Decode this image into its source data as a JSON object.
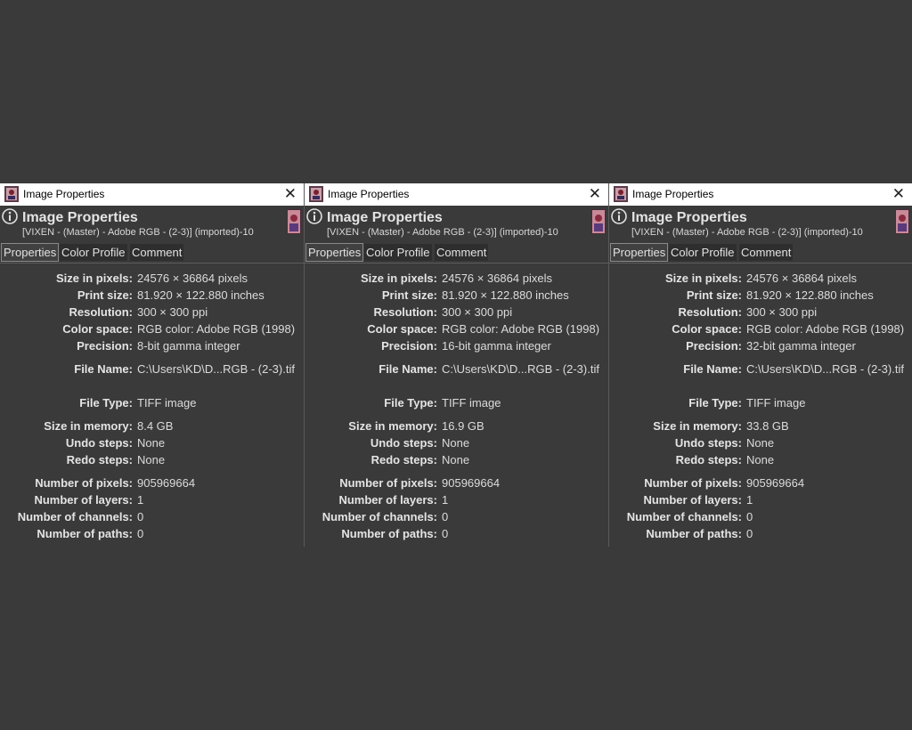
{
  "windows": [
    {
      "title": "Image Properties",
      "close": "✕",
      "header": {
        "title": "Image Properties",
        "subtitle": "[VIXEN - (Master) - Adobe RGB - (2-3)] (imported)-10"
      },
      "tabs": [
        "Properties",
        "Color Profile",
        "Comment"
      ],
      "fields": {
        "size_in_pixels": {
          "label": "Size in pixels:",
          "value": "24576 × 36864 pixels"
        },
        "print_size": {
          "label": "Print size:",
          "value": "81.920 × 122.880 inches"
        },
        "resolution": {
          "label": "Resolution:",
          "value": "300 × 300 ppi"
        },
        "color_space": {
          "label": "Color space:",
          "value": "RGB color: Adobe RGB (1998)"
        },
        "precision": {
          "label": "Precision:",
          "value": "8-bit gamma integer"
        },
        "file_name": {
          "label": "File Name:",
          "value": "C:\\Users\\KD\\D...RGB - (2-3).tif"
        },
        "file_type": {
          "label": "File Type:",
          "value": "TIFF image"
        },
        "size_in_memory": {
          "label": "Size in memory:",
          "value": "8.4 GB"
        },
        "undo_steps": {
          "label": "Undo steps:",
          "value": "None"
        },
        "redo_steps": {
          "label": "Redo steps:",
          "value": "None"
        },
        "number_of_pixels": {
          "label": "Number of pixels:",
          "value": "905969664"
        },
        "number_of_layers": {
          "label": "Number of layers:",
          "value": "1"
        },
        "number_of_channels": {
          "label": "Number of channels:",
          "value": "0"
        },
        "number_of_paths": {
          "label": "Number of paths:",
          "value": "0"
        }
      }
    },
    {
      "title": "Image Properties",
      "close": "✕",
      "header": {
        "title": "Image Properties",
        "subtitle": "[VIXEN - (Master) - Adobe RGB - (2-3)] (imported)-10"
      },
      "tabs": [
        "Properties",
        "Color Profile",
        "Comment"
      ],
      "fields": {
        "size_in_pixels": {
          "label": "Size in pixels:",
          "value": "24576 × 36864 pixels"
        },
        "print_size": {
          "label": "Print size:",
          "value": "81.920 × 122.880 inches"
        },
        "resolution": {
          "label": "Resolution:",
          "value": "300 × 300 ppi"
        },
        "color_space": {
          "label": "Color space:",
          "value": "RGB color: Adobe RGB (1998)"
        },
        "precision": {
          "label": "Precision:",
          "value": "16-bit gamma integer"
        },
        "file_name": {
          "label": "File Name:",
          "value": "C:\\Users\\KD\\D...RGB - (2-3).tif"
        },
        "file_type": {
          "label": "File Type:",
          "value": "TIFF image"
        },
        "size_in_memory": {
          "label": "Size in memory:",
          "value": "16.9 GB"
        },
        "undo_steps": {
          "label": "Undo steps:",
          "value": "None"
        },
        "redo_steps": {
          "label": "Redo steps:",
          "value": "None"
        },
        "number_of_pixels": {
          "label": "Number of pixels:",
          "value": "905969664"
        },
        "number_of_layers": {
          "label": "Number of layers:",
          "value": "1"
        },
        "number_of_channels": {
          "label": "Number of channels:",
          "value": "0"
        },
        "number_of_paths": {
          "label": "Number of paths:",
          "value": "0"
        }
      }
    },
    {
      "title": "Image Properties",
      "close": "✕",
      "header": {
        "title": "Image Properties",
        "subtitle": "[VIXEN - (Master) - Adobe RGB - (2-3)] (imported)-10"
      },
      "tabs": [
        "Properties",
        "Color Profile",
        "Comment"
      ],
      "fields": {
        "size_in_pixels": {
          "label": "Size in pixels:",
          "value": "24576 × 36864 pixels"
        },
        "print_size": {
          "label": "Print size:",
          "value": "81.920 × 122.880 inches"
        },
        "resolution": {
          "label": "Resolution:",
          "value": "300 × 300 ppi"
        },
        "color_space": {
          "label": "Color space:",
          "value": "RGB color: Adobe RGB (1998)"
        },
        "precision": {
          "label": "Precision:",
          "value": "32-bit gamma integer"
        },
        "file_name": {
          "label": "File Name:",
          "value": "C:\\Users\\KD\\D...RGB - (2-3).tif"
        },
        "file_type": {
          "label": "File Type:",
          "value": "TIFF image"
        },
        "size_in_memory": {
          "label": "Size in memory:",
          "value": "33.8 GB"
        },
        "undo_steps": {
          "label": "Undo steps:",
          "value": "None"
        },
        "redo_steps": {
          "label": "Redo steps:",
          "value": "None"
        },
        "number_of_pixels": {
          "label": "Number of pixels:",
          "value": "905969664"
        },
        "number_of_layers": {
          "label": "Number of layers:",
          "value": "1"
        },
        "number_of_channels": {
          "label": "Number of channels:",
          "value": "0"
        },
        "number_of_paths": {
          "label": "Number of paths:",
          "value": "0"
        }
      }
    }
  ],
  "icons": {
    "app": "gimp-image-icon",
    "close": "close-icon",
    "info": "info-icon",
    "thumbnail": "image-thumbnail"
  }
}
